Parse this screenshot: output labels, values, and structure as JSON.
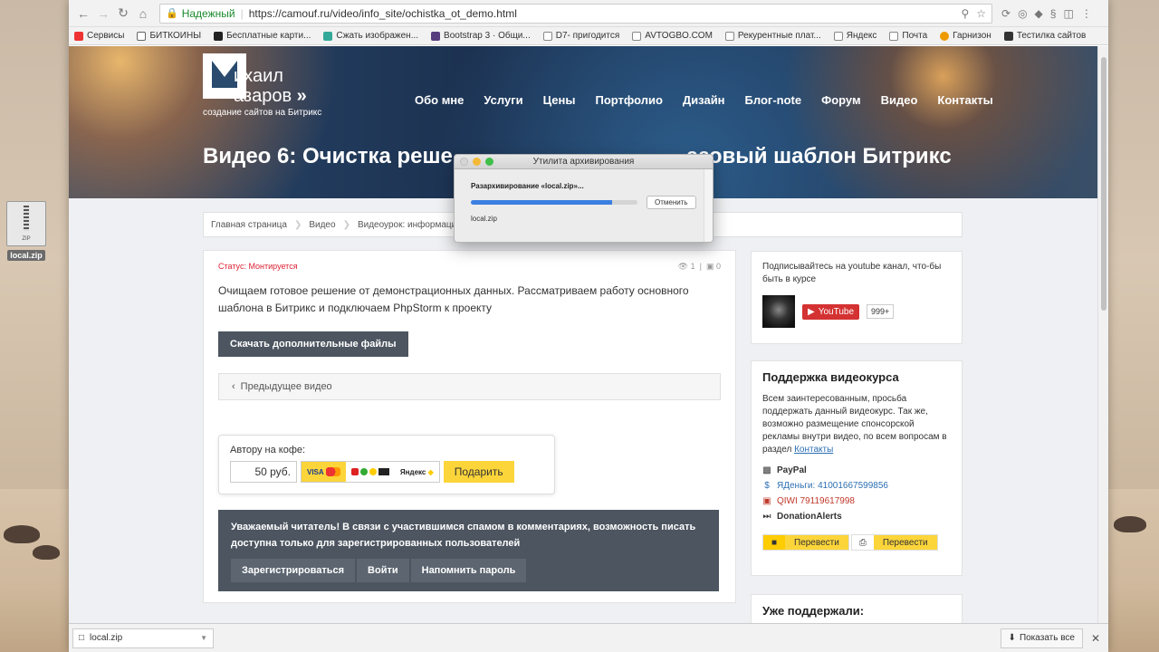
{
  "desktop": {
    "file_name": "local.zip",
    "file_badge": "ZIP"
  },
  "browser": {
    "secure_label": "Надежный",
    "url": "https://camouf.ru/video/info_site/ochistka_ot_demo.html",
    "bookmarks": [
      {
        "label": "Сервисы",
        "color": "#e33"
      },
      {
        "label": "БИТКОИНЫ",
        "color": "#444"
      },
      {
        "label": "Бесплатные карти...",
        "color": "#222"
      },
      {
        "label": "Сжать изображен...",
        "color": "#3a9"
      },
      {
        "label": "Bootstrap 3 · Общи...",
        "color": "#563d7c"
      },
      {
        "label": "D7- пригодится",
        "color": "#888"
      },
      {
        "label": "AVTOGBO.COM",
        "color": "#888"
      },
      {
        "label": "Рекурентные плат...",
        "color": "#888"
      },
      {
        "label": "Яндекс",
        "color": "#888"
      },
      {
        "label": "Почта",
        "color": "#888"
      },
      {
        "label": "Гарнизон",
        "color": "#e90"
      },
      {
        "label": "Тестилка сайтов",
        "color": "#333"
      }
    ]
  },
  "site": {
    "logo_line1": "ихаил",
    "logo_line2": "азаров",
    "logo_arrows": "»",
    "logo_tagline": "создание сайтов на Битрикс",
    "nav": [
      "Обо мне",
      "Услуги",
      "Цены",
      "Портфолио",
      "Дизайн",
      "Блог-note",
      "Форум",
      "Видео",
      "Контакты"
    ],
    "hero_title_left": "Видео 6: Очистка реше",
    "hero_title_right": "азовый шаблон Битрикс",
    "breadcrumb": [
      "Главная страница",
      "Видео",
      "Видеоурок: информационны"
    ]
  },
  "article": {
    "status": "Статус: Монтируется",
    "views": "1",
    "comments": "0",
    "description": "Очищаем готовое решение от демонстрационных данных. Рассматриваем работу основного шаблона в Битрикс и подключаем PhpStorm к проекту",
    "download_label": "Скачать дополнительные файлы",
    "prev_label": "Предыдущее видео",
    "coffee_label": "Автору на кофе:",
    "amount": "50 руб.",
    "pm_visa": "VISA",
    "pm_yandex": "Яндекс",
    "donate_label": "Подарить",
    "notice": "Уважаемый читатель! В связи с участившимся спамом в комментариях, возможность писать доступна только для зарегистрированных пользователей",
    "register_label": "Зарегистрироваться",
    "login_label": "Войти",
    "remind_label": "Напомнить пароль"
  },
  "sidebar": {
    "subscribe_text": "Подписывайтесь на youtube канал, что-бы быть в курсе",
    "youtube_label": "YouTube",
    "youtube_count": "999+",
    "support_title": "Поддержка видеокурса",
    "support_text": "Всем заинтересованным, просьба поддержать данный видеокурс. Так же, возможно размещение спонсорской рекламы внутри видео, по всем вопросам в раздел",
    "support_link": "Контакты",
    "paypal": "PayPal",
    "yandex_money": "ЯДеньги: 41001667599856",
    "qiwi": "QIWI 79119617998",
    "donationalerts": "DonationAlerts",
    "transfer1": "Перевести",
    "transfer2": "Перевести",
    "supported_title": "Уже поддержали:"
  },
  "download_bar": {
    "file": "local.zip",
    "show_all": "Показать все"
  },
  "archive_dialog": {
    "title": "Утилита архивирования",
    "status": "Разархивирование «local.zip»...",
    "cancel": "Отменить",
    "file": "local.zip",
    "progress": 0.85
  },
  "colors": {
    "accent_yellow": "#fcd53a",
    "dark_button": "#4c5560",
    "status_red": "#dd2233",
    "link_blue": "#2c6fb3"
  }
}
